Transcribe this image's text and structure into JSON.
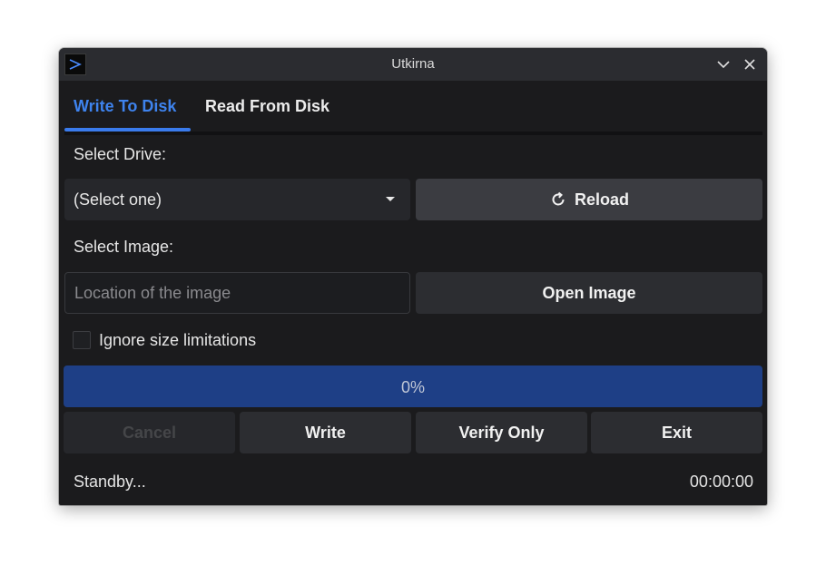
{
  "window": {
    "title": "Utkirna"
  },
  "tabs": [
    {
      "label": "Write To Disk",
      "active": true
    },
    {
      "label": "Read From Disk",
      "active": false
    }
  ],
  "drive": {
    "label": "Select Drive:",
    "selected": "(Select one)",
    "reload_label": "Reload"
  },
  "image": {
    "label": "Select Image:",
    "placeholder": "Location of the image",
    "value": "",
    "open_label": "Open Image"
  },
  "ignore_size": {
    "label": "Ignore size limitations",
    "checked": false
  },
  "progress": {
    "value": 0,
    "text": "0%"
  },
  "actions": {
    "cancel": "Cancel",
    "write": "Write",
    "verify": "Verify Only",
    "exit": "Exit"
  },
  "status": {
    "message": "Standby...",
    "timer": "00:00:00"
  },
  "colors": {
    "accent": "#3e83ee",
    "progress_track": "#1e3f86",
    "window_bg": "#1b1b1d",
    "titlebar_bg": "#2b2c30"
  },
  "icons": {
    "app": "terminal-prompt-icon",
    "minimize": "chevron-down-icon",
    "close": "close-icon",
    "reload": "refresh-icon",
    "dropdown": "caret-down-icon"
  }
}
